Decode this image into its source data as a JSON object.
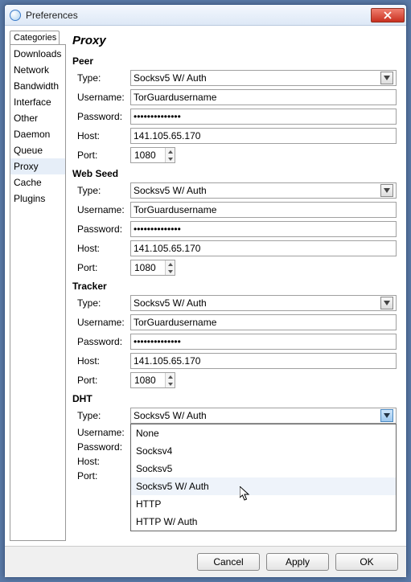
{
  "window": {
    "title": "Preferences"
  },
  "sidebar": {
    "heading": "Categories",
    "items": [
      "Downloads",
      "Network",
      "Bandwidth",
      "Interface",
      "Other",
      "Daemon",
      "Queue",
      "Proxy",
      "Cache",
      "Plugins"
    ],
    "selected": "Proxy"
  },
  "panel": {
    "title": "Proxy",
    "labels": {
      "type": "Type:",
      "username": "Username:",
      "password": "Password:",
      "host": "Host:",
      "port": "Port:"
    }
  },
  "sections": {
    "peer": {
      "title": "Peer",
      "type": "Socksv5 W/ Auth",
      "username": "TorGuardusername",
      "password": "••••••••••••••",
      "host": "141.105.65.170",
      "port": "1080"
    },
    "webseed": {
      "title": "Web Seed",
      "type": "Socksv5 W/ Auth",
      "username": "TorGuardusername",
      "password": "••••••••••••••",
      "host": "141.105.65.170",
      "port": "1080"
    },
    "tracker": {
      "title": "Tracker",
      "type": "Socksv5 W/ Auth",
      "username": "TorGuardusername",
      "password": "••••••••••••••",
      "host": "141.105.65.170",
      "port": "1080"
    },
    "dht": {
      "title": "DHT",
      "type": "Socksv5 W/ Auth",
      "username": "",
      "password": "",
      "host": "",
      "port": "",
      "options": [
        "None",
        "Socksv4",
        "Socksv5",
        "Socksv5 W/ Auth",
        "HTTP",
        "HTTP W/ Auth"
      ],
      "hover_option": "Socksv5 W/ Auth"
    }
  },
  "buttons": {
    "cancel": "Cancel",
    "apply": "Apply",
    "ok": "OK"
  }
}
